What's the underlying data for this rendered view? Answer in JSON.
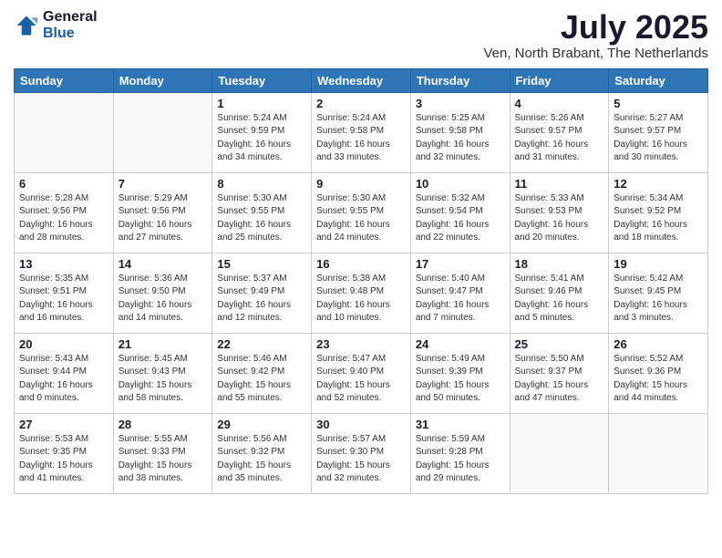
{
  "logo": {
    "general": "General",
    "blue": "Blue"
  },
  "title": "July 2025",
  "subtitle": "Ven, North Brabant, The Netherlands",
  "weekdays": [
    "Sunday",
    "Monday",
    "Tuesday",
    "Wednesday",
    "Thursday",
    "Friday",
    "Saturday"
  ],
  "weeks": [
    [
      {
        "day": "",
        "info": ""
      },
      {
        "day": "",
        "info": ""
      },
      {
        "day": "1",
        "info": "Sunrise: 5:24 AM\nSunset: 9:59 PM\nDaylight: 16 hours\nand 34 minutes."
      },
      {
        "day": "2",
        "info": "Sunrise: 5:24 AM\nSunset: 9:58 PM\nDaylight: 16 hours\nand 33 minutes."
      },
      {
        "day": "3",
        "info": "Sunrise: 5:25 AM\nSunset: 9:58 PM\nDaylight: 16 hours\nand 32 minutes."
      },
      {
        "day": "4",
        "info": "Sunrise: 5:26 AM\nSunset: 9:57 PM\nDaylight: 16 hours\nand 31 minutes."
      },
      {
        "day": "5",
        "info": "Sunrise: 5:27 AM\nSunset: 9:57 PM\nDaylight: 16 hours\nand 30 minutes."
      }
    ],
    [
      {
        "day": "6",
        "info": "Sunrise: 5:28 AM\nSunset: 9:56 PM\nDaylight: 16 hours\nand 28 minutes."
      },
      {
        "day": "7",
        "info": "Sunrise: 5:29 AM\nSunset: 9:56 PM\nDaylight: 16 hours\nand 27 minutes."
      },
      {
        "day": "8",
        "info": "Sunrise: 5:30 AM\nSunset: 9:55 PM\nDaylight: 16 hours\nand 25 minutes."
      },
      {
        "day": "9",
        "info": "Sunrise: 5:30 AM\nSunset: 9:55 PM\nDaylight: 16 hours\nand 24 minutes."
      },
      {
        "day": "10",
        "info": "Sunrise: 5:32 AM\nSunset: 9:54 PM\nDaylight: 16 hours\nand 22 minutes."
      },
      {
        "day": "11",
        "info": "Sunrise: 5:33 AM\nSunset: 9:53 PM\nDaylight: 16 hours\nand 20 minutes."
      },
      {
        "day": "12",
        "info": "Sunrise: 5:34 AM\nSunset: 9:52 PM\nDaylight: 16 hours\nand 18 minutes."
      }
    ],
    [
      {
        "day": "13",
        "info": "Sunrise: 5:35 AM\nSunset: 9:51 PM\nDaylight: 16 hours\nand 16 minutes."
      },
      {
        "day": "14",
        "info": "Sunrise: 5:36 AM\nSunset: 9:50 PM\nDaylight: 16 hours\nand 14 minutes."
      },
      {
        "day": "15",
        "info": "Sunrise: 5:37 AM\nSunset: 9:49 PM\nDaylight: 16 hours\nand 12 minutes."
      },
      {
        "day": "16",
        "info": "Sunrise: 5:38 AM\nSunset: 9:48 PM\nDaylight: 16 hours\nand 10 minutes."
      },
      {
        "day": "17",
        "info": "Sunrise: 5:40 AM\nSunset: 9:47 PM\nDaylight: 16 hours\nand 7 minutes."
      },
      {
        "day": "18",
        "info": "Sunrise: 5:41 AM\nSunset: 9:46 PM\nDaylight: 16 hours\nand 5 minutes."
      },
      {
        "day": "19",
        "info": "Sunrise: 5:42 AM\nSunset: 9:45 PM\nDaylight: 16 hours\nand 3 minutes."
      }
    ],
    [
      {
        "day": "20",
        "info": "Sunrise: 5:43 AM\nSunset: 9:44 PM\nDaylight: 16 hours\nand 0 minutes."
      },
      {
        "day": "21",
        "info": "Sunrise: 5:45 AM\nSunset: 9:43 PM\nDaylight: 15 hours\nand 58 minutes."
      },
      {
        "day": "22",
        "info": "Sunrise: 5:46 AM\nSunset: 9:42 PM\nDaylight: 15 hours\nand 55 minutes."
      },
      {
        "day": "23",
        "info": "Sunrise: 5:47 AM\nSunset: 9:40 PM\nDaylight: 15 hours\nand 52 minutes."
      },
      {
        "day": "24",
        "info": "Sunrise: 5:49 AM\nSunset: 9:39 PM\nDaylight: 15 hours\nand 50 minutes."
      },
      {
        "day": "25",
        "info": "Sunrise: 5:50 AM\nSunset: 9:37 PM\nDaylight: 15 hours\nand 47 minutes."
      },
      {
        "day": "26",
        "info": "Sunrise: 5:52 AM\nSunset: 9:36 PM\nDaylight: 15 hours\nand 44 minutes."
      }
    ],
    [
      {
        "day": "27",
        "info": "Sunrise: 5:53 AM\nSunset: 9:35 PM\nDaylight: 15 hours\nand 41 minutes."
      },
      {
        "day": "28",
        "info": "Sunrise: 5:55 AM\nSunset: 9:33 PM\nDaylight: 15 hours\nand 38 minutes."
      },
      {
        "day": "29",
        "info": "Sunrise: 5:56 AM\nSunset: 9:32 PM\nDaylight: 15 hours\nand 35 minutes."
      },
      {
        "day": "30",
        "info": "Sunrise: 5:57 AM\nSunset: 9:30 PM\nDaylight: 15 hours\nand 32 minutes."
      },
      {
        "day": "31",
        "info": "Sunrise: 5:59 AM\nSunset: 9:28 PM\nDaylight: 15 hours\nand 29 minutes."
      },
      {
        "day": "",
        "info": ""
      },
      {
        "day": "",
        "info": ""
      }
    ]
  ]
}
